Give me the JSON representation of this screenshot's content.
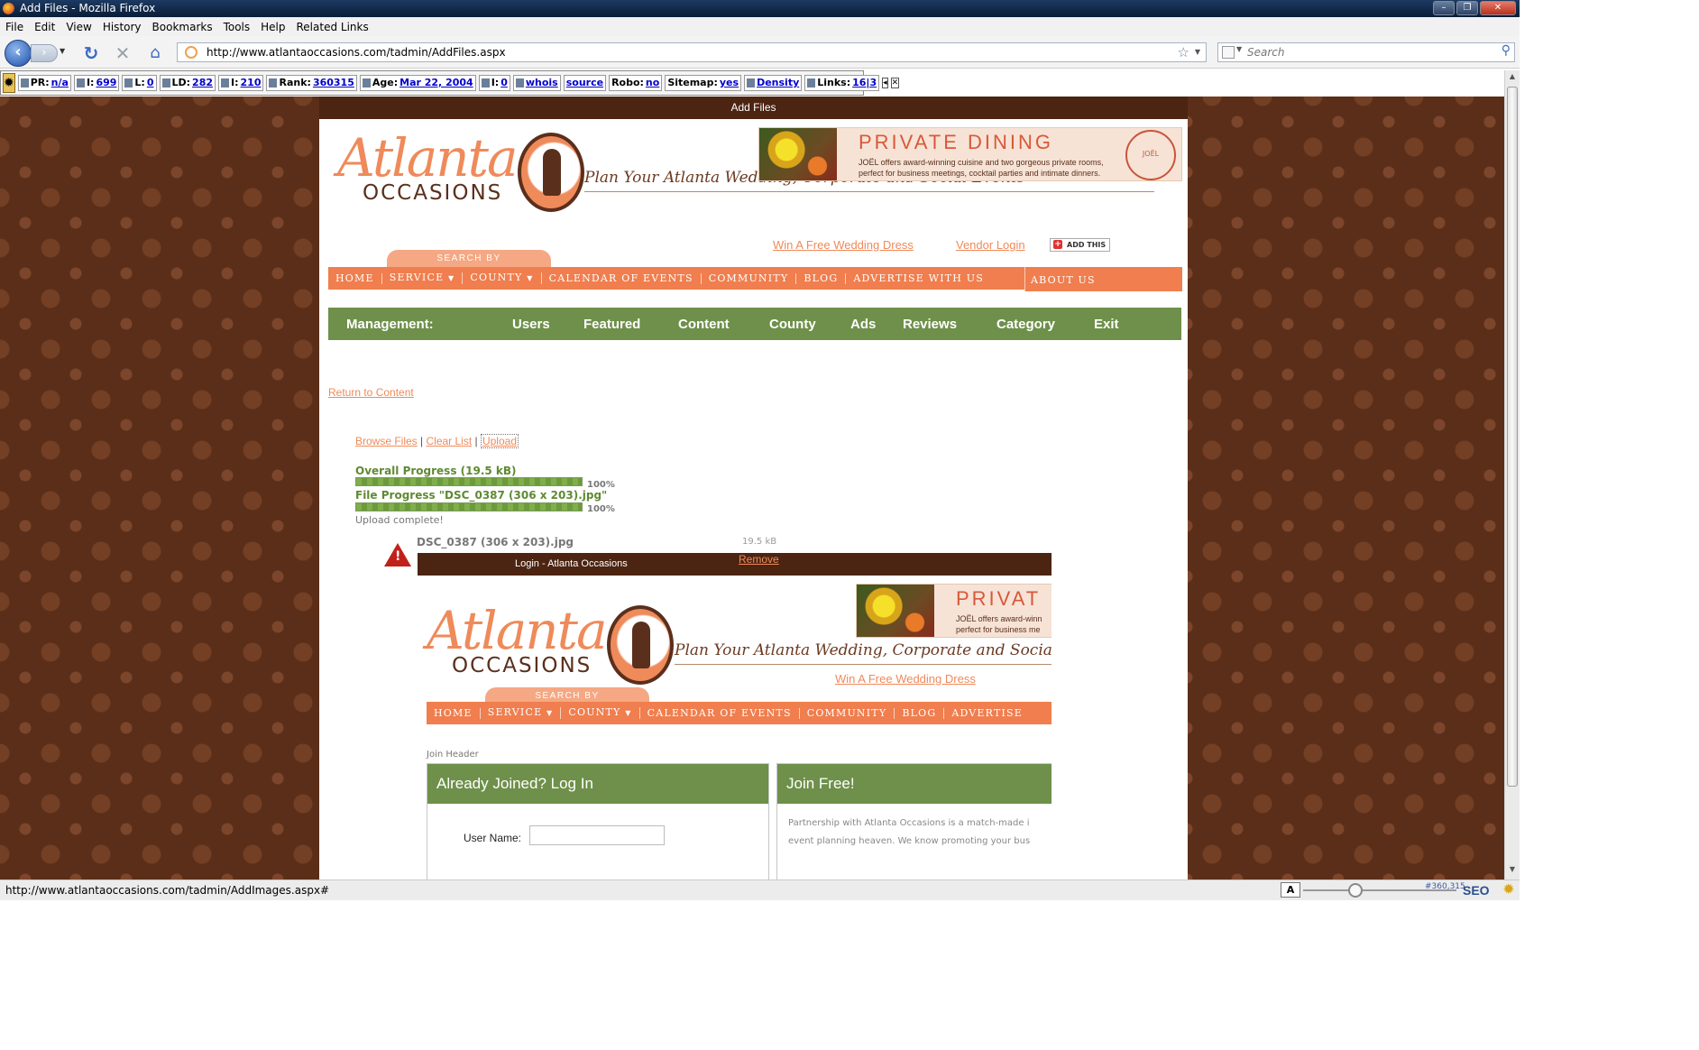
{
  "window": {
    "title": "Add Files - Mozilla Firefox"
  },
  "menu": [
    "File",
    "Edit",
    "View",
    "History",
    "Bookmarks",
    "Tools",
    "Help",
    "Related Links"
  ],
  "nav": {
    "url": "http://www.atlantaoccasions.com/tadmin/AddFiles.aspx",
    "search_placeholder": "Search"
  },
  "seo": {
    "pr_label": "PR:",
    "pr": "n/a",
    "i1_label": "I:",
    "i1": "699",
    "l_label": "L:",
    "l": "0",
    "ld_label": "LD:",
    "ld": "282",
    "i2_label": "I:",
    "i2": "210",
    "rank_label": "Rank:",
    "rank": "360315",
    "age_label": "Age:",
    "age": "Mar 22, 2004",
    "i3_label": "I:",
    "i3": "0",
    "whois": "whois",
    "source": "source",
    "robo_label": "Robo:",
    "robo": "no",
    "sitemap_label": "Sitemap:",
    "sitemap": "yes",
    "density": "Density",
    "links_label": "Links:",
    "links": "16|3"
  },
  "page": {
    "header_title": "Add Files",
    "logo_word1": "Atlanta",
    "logo_word2": "OCCASIONS",
    "tagline": "Plan Your Atlanta Wedding, Corporate and Social Events",
    "ad": {
      "title": "PRIVATE DINING",
      "text": "JOËL offers award-winning cuisine and two gorgeous private rooms, perfect for business meetings, cocktail parties and intimate dinners.",
      "seal": "JOËL"
    },
    "links": {
      "win": "Win A Free Wedding Dress",
      "vendor": "Vendor Login",
      "addthis": "ADD THIS"
    },
    "search_by": "SEARCH BY",
    "site_nav": [
      "HOME",
      "SERVICE",
      "COUNTY",
      "CALENDAR OF EVENTS",
      "COMMUNITY",
      "BLOG",
      "ADVERTISE WITH US"
    ],
    "about": "ABOUT US",
    "management": {
      "label": "Management:",
      "items": [
        "Users",
        "Featured",
        "Content",
        "County",
        "Ads",
        "Reviews",
        "Category",
        "Exit"
      ]
    },
    "return_link": "Return to Content",
    "uploader": {
      "browse": "Browse Files",
      "clear": "Clear List",
      "upload": "Upload",
      "overall_label": "Overall Progress (19.5 kB)",
      "overall_pct": "100%",
      "overall_fraction": 1.0,
      "file_label": "File Progress \"DSC_0387 (306 x 203).jpg\"",
      "file_pct": "100%",
      "file_fraction": 1.0,
      "done": "Upload complete!",
      "file_name": "DSC_0387 (306 x 203).jpg",
      "file_size": "19.5 kB",
      "remove": "Remove"
    },
    "frame": {
      "header_title": "Login - Atlanta Occasions",
      "ad_title": "PRIVAT",
      "ad_text": "JOËL offers award-winn perfect for business me",
      "win": "Win A Free Wedding Dress",
      "site_nav": [
        "HOME",
        "SERVICE",
        "COUNTY",
        "CALENDAR OF EVENTS",
        "COMMUNITY",
        "BLOG",
        "ADVERTISE"
      ],
      "join_header_label": "Join Header",
      "login_title": "Already Joined? Log In",
      "username_label": "User Name:",
      "join_title": "Join Free!",
      "join_text": "Partnership with Atlanta Occasions is a match-made i event planning heaven. We know promoting your bus"
    }
  },
  "status": {
    "text": "http://www.atlantaoccasions.com/tadmin/AddImages.aspx#",
    "rank": "#360,315",
    "seo_logo": "SEO"
  }
}
